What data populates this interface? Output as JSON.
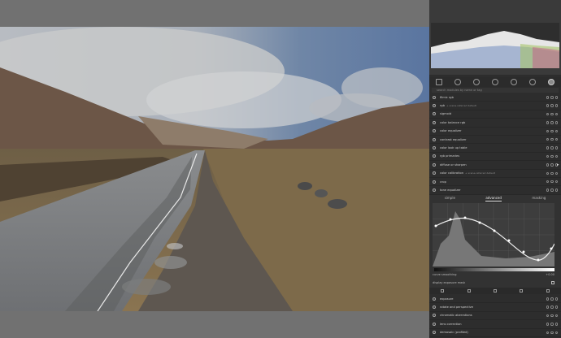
{
  "modules": [
    {
      "name": "filmic rgb",
      "sub": ""
    },
    {
      "name": "rgb",
      "sub": "+ scene-referred default"
    },
    {
      "name": "sigmoid",
      "sub": ""
    },
    {
      "name": "color balance rgb",
      "sub": ""
    },
    {
      "name": "color equalizer",
      "sub": ""
    },
    {
      "name": "contrast equalizer",
      "sub": ""
    },
    {
      "name": "color look up table",
      "sub": ""
    },
    {
      "name": "rgb primaries",
      "sub": ""
    },
    {
      "name": "diffuse or sharpen",
      "sub": ""
    },
    {
      "name": "color calibration",
      "sub": "+ scene-referred default"
    },
    {
      "name": "crop",
      "sub": ""
    },
    {
      "name": "tone equalizer",
      "sub": ""
    }
  ],
  "tone_tabs": [
    "simple",
    "advanced",
    "masking"
  ],
  "tone_active_tab": "advanced",
  "curve_smoothing_label": "curve smoothing",
  "curve_smoothing_value": "+0.00",
  "preserve_label": "display exposure mask",
  "lower_modules": [
    {
      "name": "exposure"
    },
    {
      "name": "rotate and perspective"
    },
    {
      "name": "chromatic aberrations"
    },
    {
      "name": "lens correction"
    },
    {
      "name": "demosaic (profiled)"
    }
  ],
  "search_placeholder": "search modules by name or tag",
  "colors": {
    "panel": "#2d2d2d",
    "accent": "#d9d9d9",
    "active_tab": "#8a8a8a"
  }
}
